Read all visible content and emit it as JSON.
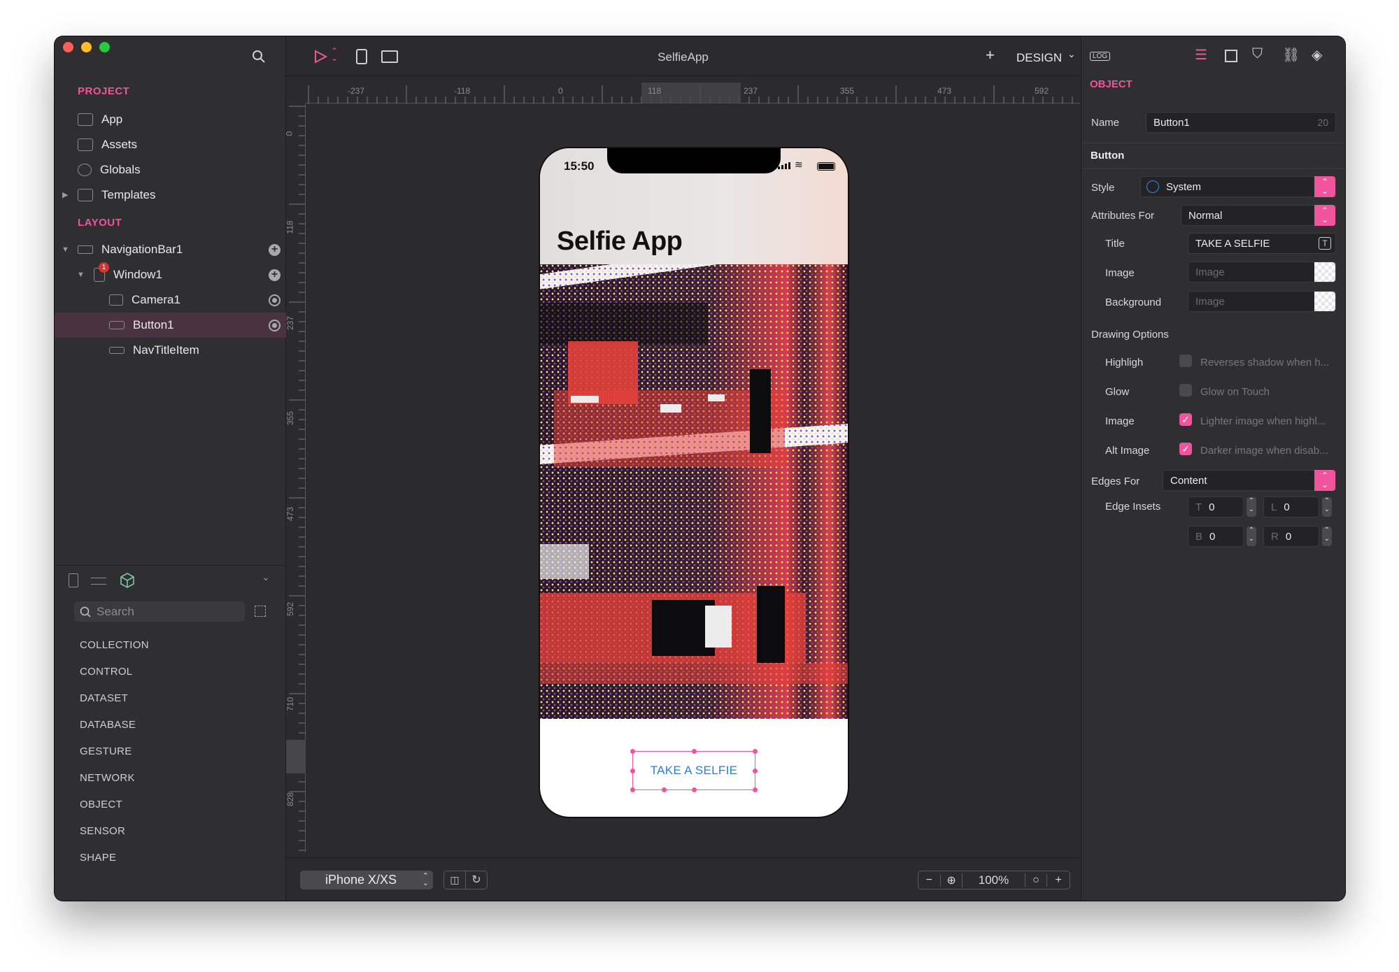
{
  "app": {
    "title": "SelfieApp",
    "mode": "DESIGN"
  },
  "sidebar": {
    "project_header": "PROJECT",
    "project_items": [
      {
        "label": "App",
        "icon": "app-icon"
      },
      {
        "label": "Assets",
        "icon": "assets-icon"
      },
      {
        "label": "Globals",
        "icon": "globals-icon"
      },
      {
        "label": "Templates",
        "icon": "templates-icon"
      }
    ],
    "layout_header": "LAYOUT",
    "layout_items": [
      {
        "label": "NavigationBar1",
        "icon": "navbar-icon"
      },
      {
        "label": "Window1",
        "icon": "window-icon",
        "badge": "1"
      },
      {
        "label": "Camera1",
        "icon": "camera-icon"
      },
      {
        "label": "Button1",
        "icon": "button-icon",
        "selected": true
      },
      {
        "label": "NavTitleItem",
        "icon": "navtitle-icon"
      }
    ],
    "search_placeholder": "Search",
    "categories": [
      "COLLECTION",
      "CONTROL",
      "DATASET",
      "DATABASE",
      "GESTURE",
      "NETWORK",
      "OBJECT",
      "SENSOR",
      "SHAPE"
    ]
  },
  "canvas": {
    "ruler_top": [
      "-237",
      "-118",
      "0",
      "118",
      "237",
      "355",
      "473",
      "592"
    ],
    "ruler_left": [
      "0",
      "118",
      "237",
      "355",
      "473",
      "592",
      "710",
      "828"
    ],
    "device": "iPhone X/XS",
    "zoom": "100%",
    "phone": {
      "time": "15:50",
      "nav_title": "Selfie App",
      "button_label": "TAKE A SELFIE"
    }
  },
  "inspector": {
    "header": "OBJECT",
    "log_label": "LOG",
    "name_label": "Name",
    "name_value": "Button1",
    "name_count": "20",
    "section": "Button",
    "style_label": "Style",
    "style_value": "System",
    "attrs_label": "Attributes For",
    "attrs_value": "Normal",
    "title_label": "Title",
    "title_value": "TAKE A SELFIE",
    "image_label": "Image",
    "image_placeholder": "Image",
    "background_label": "Background",
    "background_placeholder": "Image",
    "drawing_label": "Drawing Options",
    "options": [
      {
        "label": "Highligh",
        "desc": "Reverses shadow when h...",
        "checked": false
      },
      {
        "label": "Glow",
        "desc": "Glow on Touch",
        "checked": false
      },
      {
        "label": "Image",
        "desc": "Lighter image when highl...",
        "checked": true
      },
      {
        "label": "Alt Image",
        "desc": "Darker image when disab...",
        "checked": true
      }
    ],
    "edges_label": "Edges For",
    "edges_value": "Content",
    "insets_label": "Edge Insets",
    "insets": {
      "T": "0",
      "L": "0",
      "B": "0",
      "R": "0"
    },
    "inset_keys": {
      "t": "T",
      "l": "L",
      "b": "B",
      "r": "R"
    }
  },
  "colors": {
    "accent": "#f0549c",
    "selection": "#4a3340",
    "button_text": "#2f7bd6"
  }
}
